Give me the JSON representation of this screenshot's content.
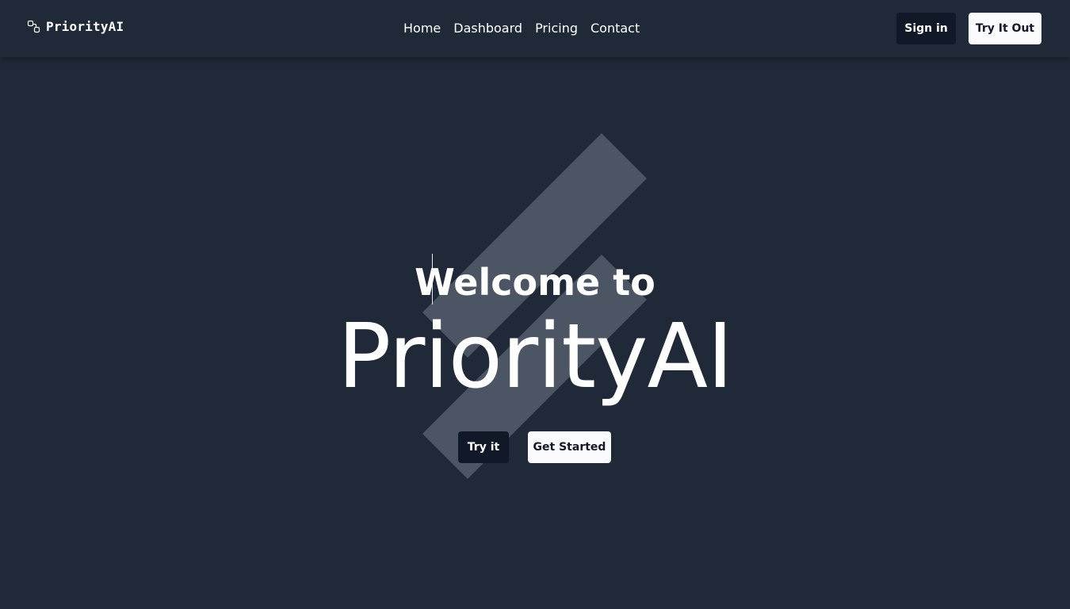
{
  "navbar": {
    "brand": {
      "name": "PriorityAI",
      "icon": "link-icon"
    },
    "links": [
      {
        "label": "Home"
      },
      {
        "label": "Dashboard"
      },
      {
        "label": "Pricing"
      },
      {
        "label": "Contact"
      }
    ],
    "sign_in_label": "Sign in",
    "try_it_out_label": "Try It Out"
  },
  "hero": {
    "welcome": "Welcome to",
    "title": "PriorityAI",
    "try_label": "Try it",
    "get_started_label": "Get Started"
  },
  "colors": {
    "background": "#1f2937",
    "dark_button": "#111827",
    "light_button": "#f9fafb",
    "decor_stripes": "#4b5563"
  }
}
